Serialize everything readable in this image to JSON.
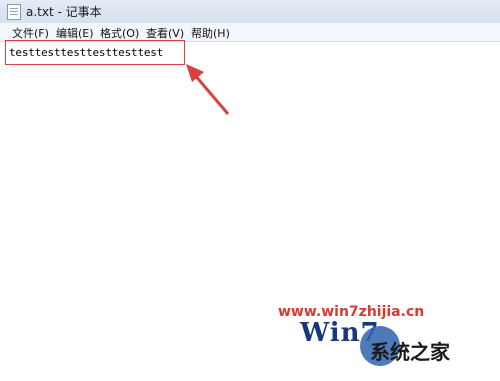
{
  "window": {
    "title": "a.txt - 记事本",
    "icon": "notepad-icon"
  },
  "menu": [
    {
      "label": "文件(F)"
    },
    {
      "label": "编辑(E)"
    },
    {
      "label": "格式(O)"
    },
    {
      "label": "查看(V)"
    },
    {
      "label": "帮助(H)"
    }
  ],
  "editor": {
    "content": "testtesttesttesttesttest"
  },
  "annotation": {
    "color": "#d94040"
  },
  "watermark": {
    "url": "www.win7zhijia.cn",
    "brand": "系统之家",
    "logo_text": "Win7"
  }
}
